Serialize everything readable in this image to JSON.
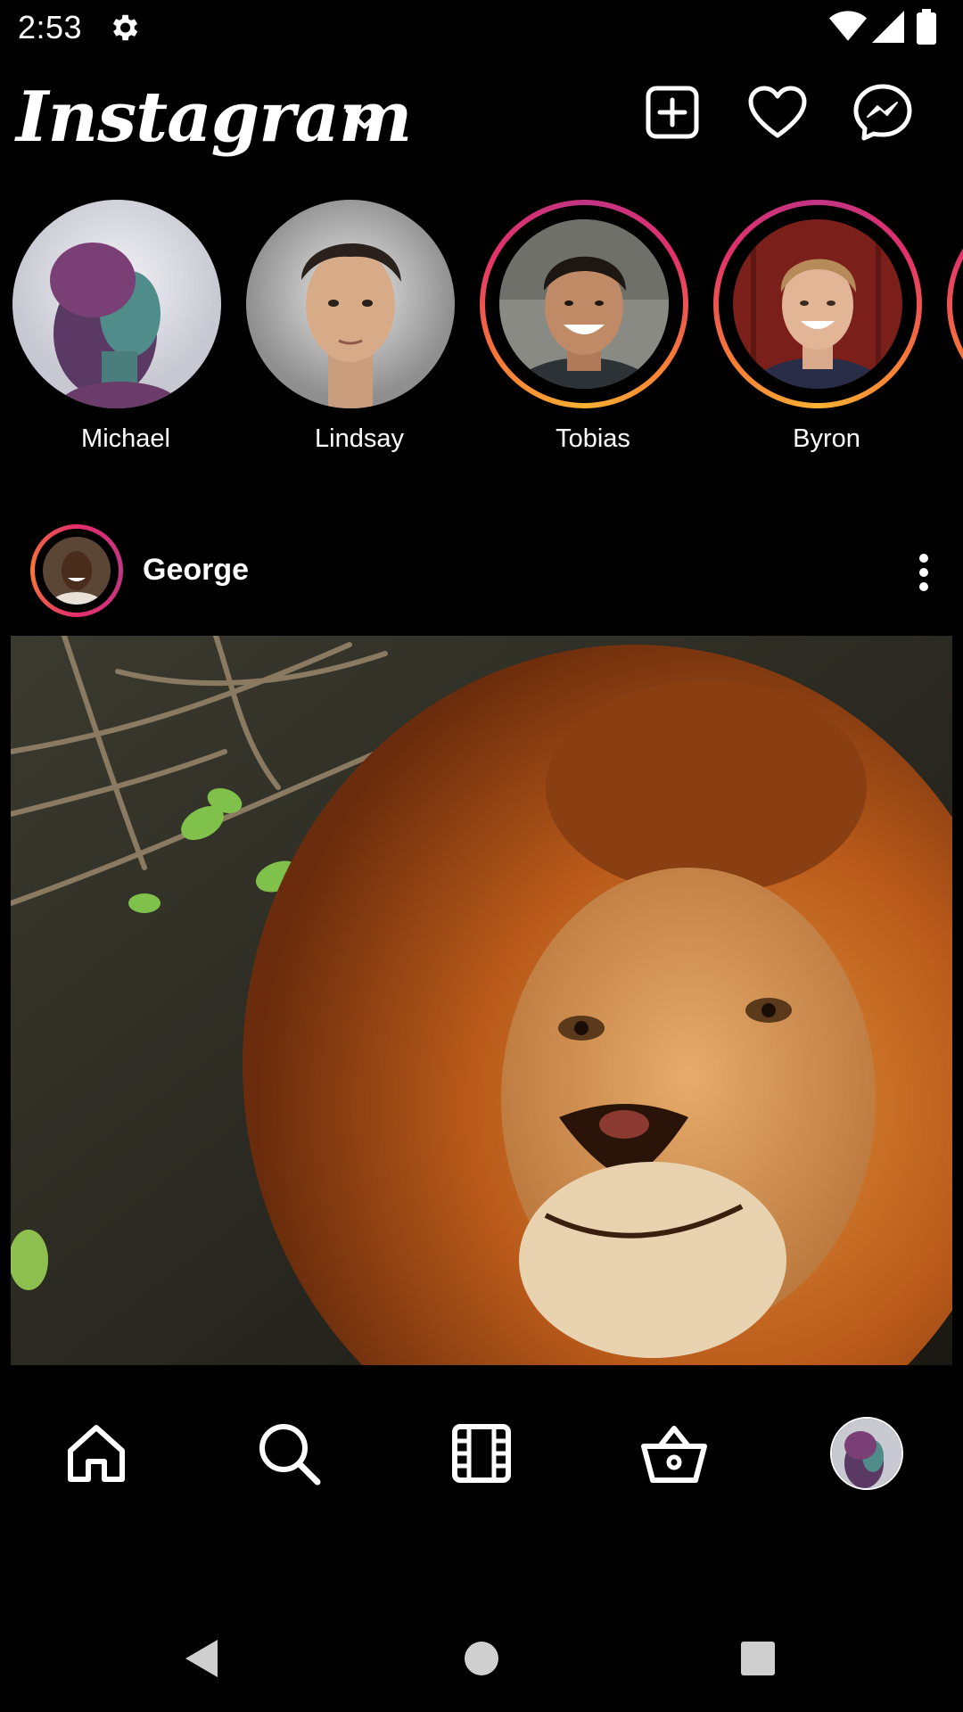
{
  "status_bar": {
    "time": "2:53",
    "icons": [
      "gear-icon",
      "wifi-icon",
      "signal-icon",
      "battery-icon"
    ]
  },
  "header": {
    "app_name": "Instagram",
    "actions": [
      "new-post-icon",
      "heart-icon",
      "messenger-icon"
    ]
  },
  "stories": [
    {
      "name": "Michael",
      "ring": "seen"
    },
    {
      "name": "Lindsay",
      "ring": "seen"
    },
    {
      "name": "Tobias",
      "ring": "active"
    },
    {
      "name": "Byron",
      "ring": "active"
    }
  ],
  "post": {
    "username": "George",
    "image_subject": "lion"
  },
  "bottom_nav": [
    "home-icon",
    "search-icon",
    "reels-icon",
    "shop-icon",
    "profile-avatar"
  ],
  "colors": {
    "background": "#000000",
    "text": "#ffffff",
    "ring_pink": "#e1306c",
    "ring_orange": "#f9b233"
  }
}
